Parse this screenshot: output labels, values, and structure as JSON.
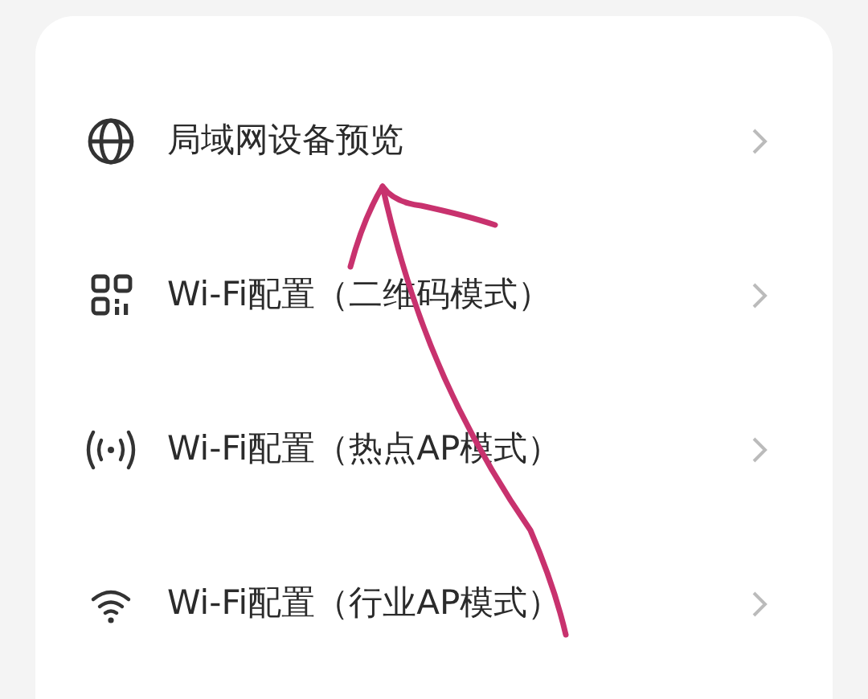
{
  "menu": [
    {
      "label": "局域网设备预览"
    },
    {
      "label": "Wi-Fi配置（二维码模式）"
    },
    {
      "label": "Wi-Fi配置（热点AP模式）"
    },
    {
      "label": "Wi-Fi配置（行业AP模式）"
    }
  ]
}
